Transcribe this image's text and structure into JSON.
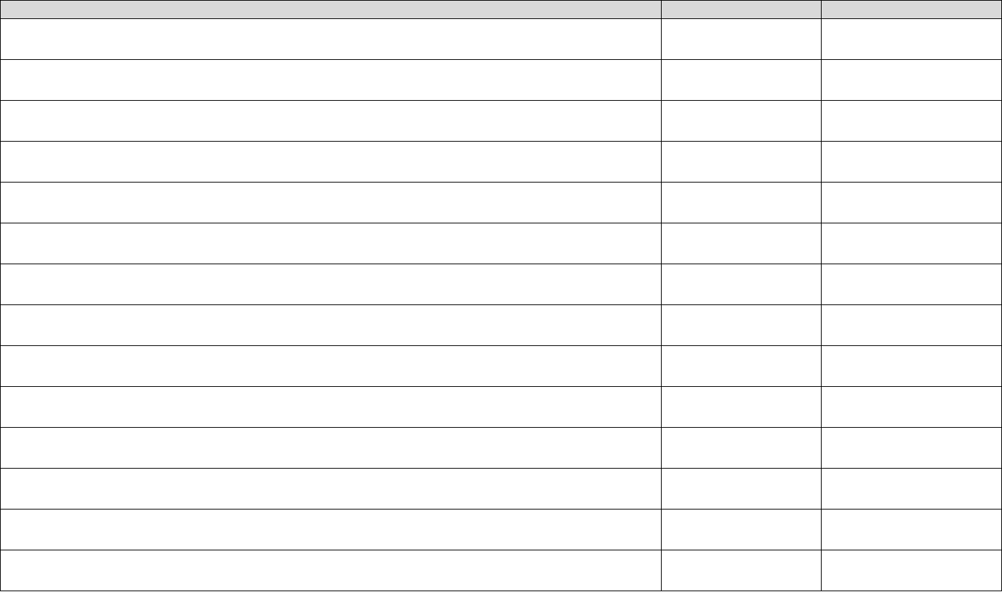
{
  "table": {
    "headers": [
      "",
      "",
      ""
    ],
    "rows": [
      [
        "",
        "",
        ""
      ],
      [
        "",
        "",
        ""
      ],
      [
        "",
        "",
        ""
      ],
      [
        "",
        "",
        ""
      ],
      [
        "",
        "",
        ""
      ],
      [
        "",
        "",
        ""
      ],
      [
        "",
        "",
        ""
      ],
      [
        "",
        "",
        ""
      ],
      [
        "",
        "",
        ""
      ],
      [
        "",
        "",
        ""
      ],
      [
        "",
        "",
        ""
      ],
      [
        "",
        "",
        ""
      ],
      [
        "",
        "",
        ""
      ],
      [
        "",
        "",
        ""
      ]
    ]
  }
}
